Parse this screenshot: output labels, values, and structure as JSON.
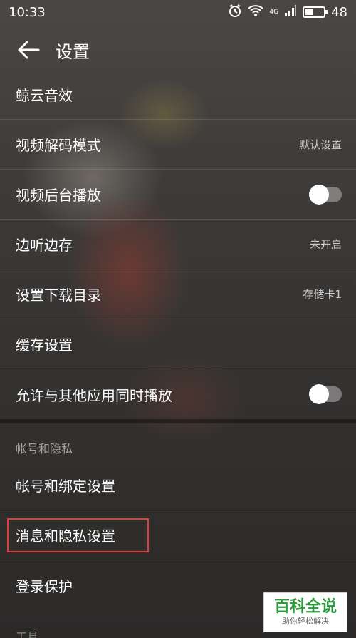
{
  "status_bar": {
    "time": "10:33",
    "network": "4G",
    "battery": "48"
  },
  "header": {
    "title": "设置",
    "back_icon": "arrow-left-icon"
  },
  "settings": [
    {
      "label": "鲸云音效",
      "value": "",
      "control": "none"
    },
    {
      "label": "视频解码模式",
      "value": "默认设置",
      "control": "value"
    },
    {
      "label": "视频后台播放",
      "value": "",
      "control": "toggle",
      "on": false
    },
    {
      "label": "边听边存",
      "value": "未开启",
      "control": "value"
    },
    {
      "label": "设置下载目录",
      "value": "存储卡1",
      "control": "value"
    },
    {
      "label": "缓存设置",
      "value": "",
      "control": "none"
    },
    {
      "label": "允许与其他应用同时播放",
      "value": "",
      "control": "toggle",
      "on": false
    }
  ],
  "account_section": {
    "title": "帐号和隐私",
    "items": [
      {
        "label": "帐号和绑定设置"
      },
      {
        "label": "消息和隐私设置",
        "highlighted": true
      },
      {
        "label": "登录保护"
      }
    ]
  },
  "next_section_partial": "工具",
  "watermark": {
    "title": "百科全说",
    "subtitle": "助你轻松解决"
  },
  "colors": {
    "highlight_border": "#e23b3b",
    "watermark_green": "#2a9a3c"
  }
}
